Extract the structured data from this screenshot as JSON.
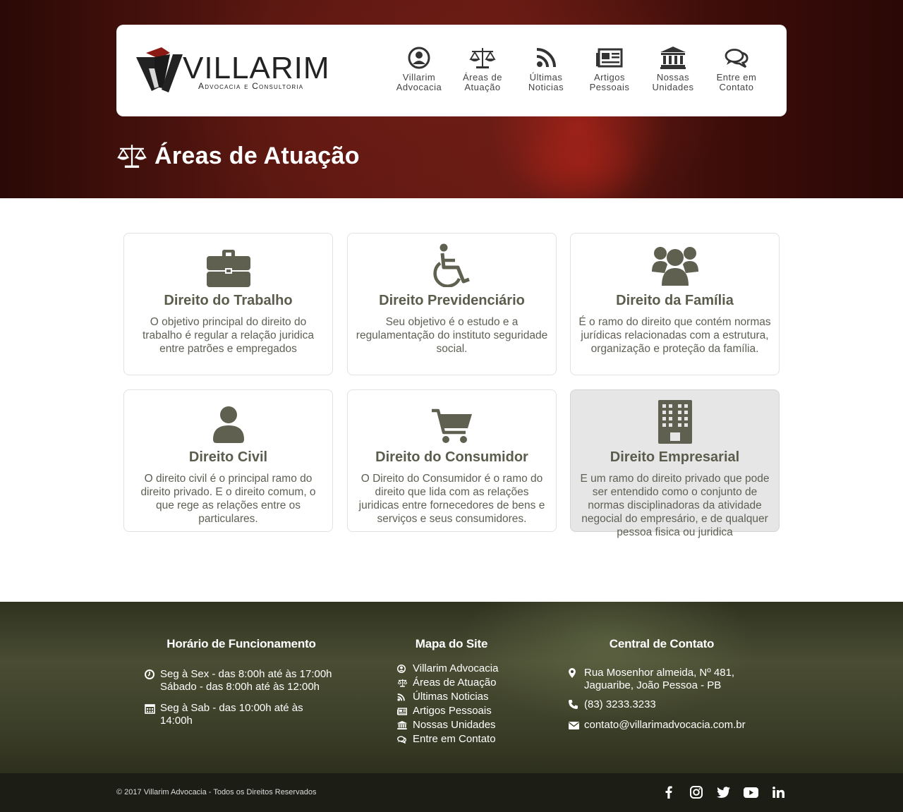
{
  "brand": {
    "name": "VILLARIM",
    "tagline": "Advocacia e Consultoria"
  },
  "nav": {
    "items": [
      {
        "label": "Villarim\nAdvocacia",
        "icon": "user-circle-icon"
      },
      {
        "label": "Áreas de\nAtuação",
        "icon": "scales-icon"
      },
      {
        "label": "Últimas\nNoticias",
        "icon": "rss-icon"
      },
      {
        "label": "Artigos\nPessoais",
        "icon": "newspaper-icon"
      },
      {
        "label": "Nossas\nUnidades",
        "icon": "institution-icon"
      },
      {
        "label": "Entre em\nContato",
        "icon": "chat-icon"
      }
    ]
  },
  "page": {
    "title": "Áreas de Atuação"
  },
  "cards": [
    {
      "title": "Direito do Trabalho",
      "text": "O objetivo principal do direito do trabalho é regular a relação juridica entre patrões e empregados",
      "icon": "briefcase-icon"
    },
    {
      "title": "Direito Previdenciário",
      "text": "Seu objetivo é o estudo e a regulamentação do instituto seguridade social.",
      "icon": "wheelchair-icon"
    },
    {
      "title": "Direito da Família",
      "text": "É o ramo do direito que contém normas jurídicas relacionadas com a estrutura, organização e proteção da família.",
      "icon": "group-icon"
    },
    {
      "title": "Direito Civil",
      "text": "O direito civil é o principal ramo do direito privado. E o direito comum, o que rege as relações entre os particulares.",
      "icon": "user-icon"
    },
    {
      "title": "Direito do Consumidor",
      "text": "O Direito do Consumidor é o ramo do direito que lida com as relações juridicas entre fornecedores de bens e serviços e seus consumidores.",
      "icon": "cart-icon"
    },
    {
      "title": "Direito Empresarial",
      "text": "E um ramo do direito privado que pode ser entendido como o conjunto de normas disciplinadoras da atividade negocial do empresário, e de qualquer pessoa fisica ou juridica",
      "icon": "building-icon"
    }
  ],
  "footer": {
    "hours": {
      "title": "Horário de Funcionamento",
      "line1": "Seg à Sex - das 8:00h até às 17:00h",
      "line2": "Sábado - das 8:00h até às 12:00h",
      "line3": "Seg à Sab - das 10:00h até às 14:00h"
    },
    "sitemap": {
      "title": "Mapa do Site",
      "items": [
        "Villarim Advocacia",
        "Áreas de Atuação",
        "Últimas Noticias",
        "Artigos Pessoais",
        "Nossas Unidades",
        "Entre em Contato"
      ]
    },
    "contact": {
      "title": "Central de Contato",
      "address": "Rua Mosenhor almeida, Nº 481, Jaguaribe, João Pessoa - PB",
      "phone": "(83) 3233.3233",
      "email": "contato@villarimadvocacia.com.br"
    },
    "copyright": "© 2017 Villarim Advocacia - Todos os Direitos Reservados",
    "social": [
      "facebook-icon",
      "instagram-icon",
      "twitter-icon",
      "youtube-icon",
      "linkedin-icon"
    ]
  },
  "colors": {
    "hero": "#5a1711",
    "nav_text": "#444444",
    "card_icon": "#5f604f",
    "card_title": "#5c5c4c",
    "footer_bg": "#3d4029",
    "bottom_bar": "#1c1d14"
  }
}
